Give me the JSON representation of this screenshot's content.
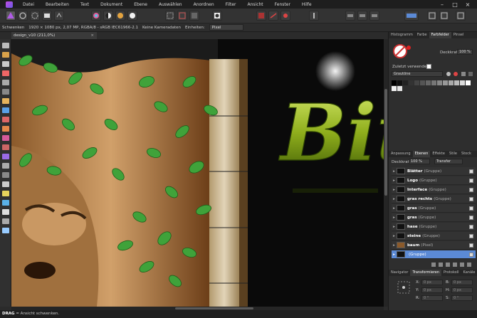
{
  "menu": [
    "Datei",
    "Bearbeiten",
    "Text",
    "Dokument",
    "Ebene",
    "Auswählen",
    "Anordnen",
    "Filter",
    "Ansicht",
    "Fenster",
    "Hilfe"
  ],
  "context": {
    "tool": "Schwenken",
    "info": "1920 × 1080 px, 2,07 MP, RGBA/8 - sRGB IEC61966-2.1",
    "camera": "Keine Kameradaten",
    "units_label": "Einheiten:",
    "units_value": "Pixel"
  },
  "document_tab": "design_v10 (211,0%)",
  "canvas_text": "Bit",
  "color_panel": {
    "tabs": [
      "Histogramm",
      "Farbe",
      "Farbfelder",
      "Pinsel"
    ],
    "active": 2,
    "opacity_label": "Deckkraft:",
    "opacity_value": "100 %",
    "recent_label": "Zuletzt verwendet:",
    "palette": "Grautöne"
  },
  "layers_panel": {
    "tabs": [
      "Anpassung",
      "Ebenen",
      "Effekte",
      "Stile",
      "Stock"
    ],
    "active": 1,
    "opacity_label": "Deckkraft:",
    "opacity_value": "100 %",
    "blend": "Transfer",
    "layers": [
      {
        "name": "Blätter",
        "type": "(Gruppe)"
      },
      {
        "name": "Logo",
        "type": "(Gruppe)"
      },
      {
        "name": "Interface",
        "type": "(Gruppe)"
      },
      {
        "name": "gras rechts",
        "type": "(Gruppe)"
      },
      {
        "name": "gras",
        "type": "(Gruppe)"
      },
      {
        "name": "gras",
        "type": "(Gruppe)"
      },
      {
        "name": "hase",
        "type": "(Gruppe)"
      },
      {
        "name": "steine",
        "type": "(Gruppe)"
      },
      {
        "name": "baum",
        "type": "(Pixel)"
      },
      {
        "name": "",
        "type": "(Gruppe)"
      }
    ]
  },
  "bottom_panel": {
    "tabs": [
      "Navigator",
      "Transformieren",
      "Protokoll",
      "Kanäle"
    ],
    "active": 1,
    "fields": [
      {
        "label": "X:",
        "value": "0 px"
      },
      {
        "label": "B:",
        "value": "0 px"
      },
      {
        "label": "Y:",
        "value": "0 px"
      },
      {
        "label": "H:",
        "value": "0 px"
      },
      {
        "label": "R:",
        "value": "0 °"
      },
      {
        "label": "S:",
        "value": "0 °"
      }
    ]
  },
  "status": {
    "key": "DRAG",
    "text": " = Ansicht schwenken."
  },
  "colors": {
    "accent": "#5b8ad6",
    "leaf": "#3fa23a",
    "text_3d": "#8fae1c"
  }
}
